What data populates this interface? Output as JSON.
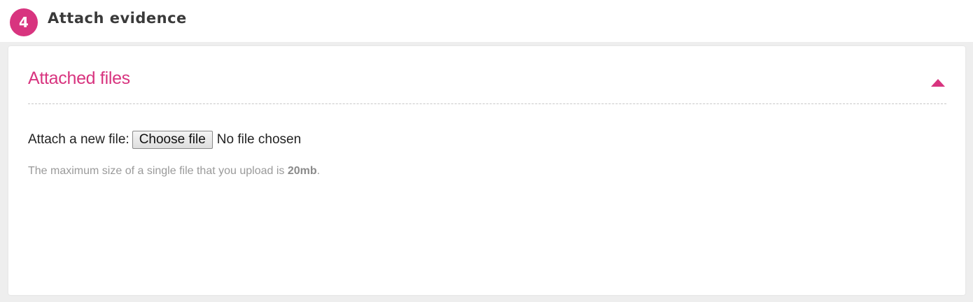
{
  "step": {
    "number": "4",
    "title": "Attach evidence"
  },
  "panel": {
    "title": "Attached files",
    "toggle_icon": "caret-up-icon"
  },
  "file_input": {
    "label": "Attach a new file:",
    "button_label": "Choose file",
    "status": "No file chosen"
  },
  "hint": {
    "text": "The maximum size of a single file that you upload is ",
    "limit": "20mb",
    "suffix": "."
  },
  "colors": {
    "accent": "#d8347f",
    "text": "#222222",
    "muted": "#9a9a9a"
  }
}
